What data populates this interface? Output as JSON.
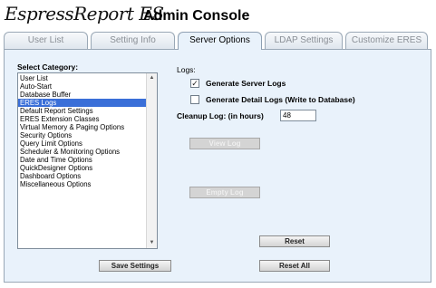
{
  "header": {
    "logo_text": "EspressReport ES",
    "title": "Admin Console"
  },
  "tabs": [
    {
      "label": "User List"
    },
    {
      "label": "Setting Info"
    },
    {
      "label": "Server Options"
    },
    {
      "label": "LDAP Settings"
    },
    {
      "label": "Customize ERES"
    }
  ],
  "active_tab": "Server Options",
  "category": {
    "label": "Select Category:",
    "items": [
      "User List",
      "Auto-Start",
      "Database Buffer",
      "ERES Logs",
      "Default Report Settings",
      "ERES Extension Classes",
      "Virtual Memory & Paging Options",
      "Security Options",
      "Query Limit Options",
      "Scheduler & Monitoring Options",
      "Date and Time Options",
      "QuickDesigner Options",
      "Dashboard Options",
      "Miscellaneous Options"
    ],
    "selected": "ERES Logs"
  },
  "logs": {
    "section_label": "Logs:",
    "generate_server_logs": {
      "label": "Generate Server Logs",
      "checked": true
    },
    "generate_detail_logs": {
      "label": "Generate Detail Logs (Write to Database)",
      "checked": false
    },
    "cleanup_label": "Cleanup Log: (in hours)",
    "cleanup_value": "48"
  },
  "buttons": {
    "save": "Save Settings",
    "view_log": "View Log",
    "empty_log": "Empty Log",
    "reset": "Reset",
    "reset_all": "Reset All"
  },
  "icons": {
    "checkmark": "checkmark-icon",
    "scroll_up": "triangle-up-icon",
    "scroll_down": "triangle-down-icon"
  },
  "colors": {
    "panel_bg": "#e9f2fb",
    "selection": "#3a6fd8",
    "tab_border": "#9aa8b6"
  }
}
